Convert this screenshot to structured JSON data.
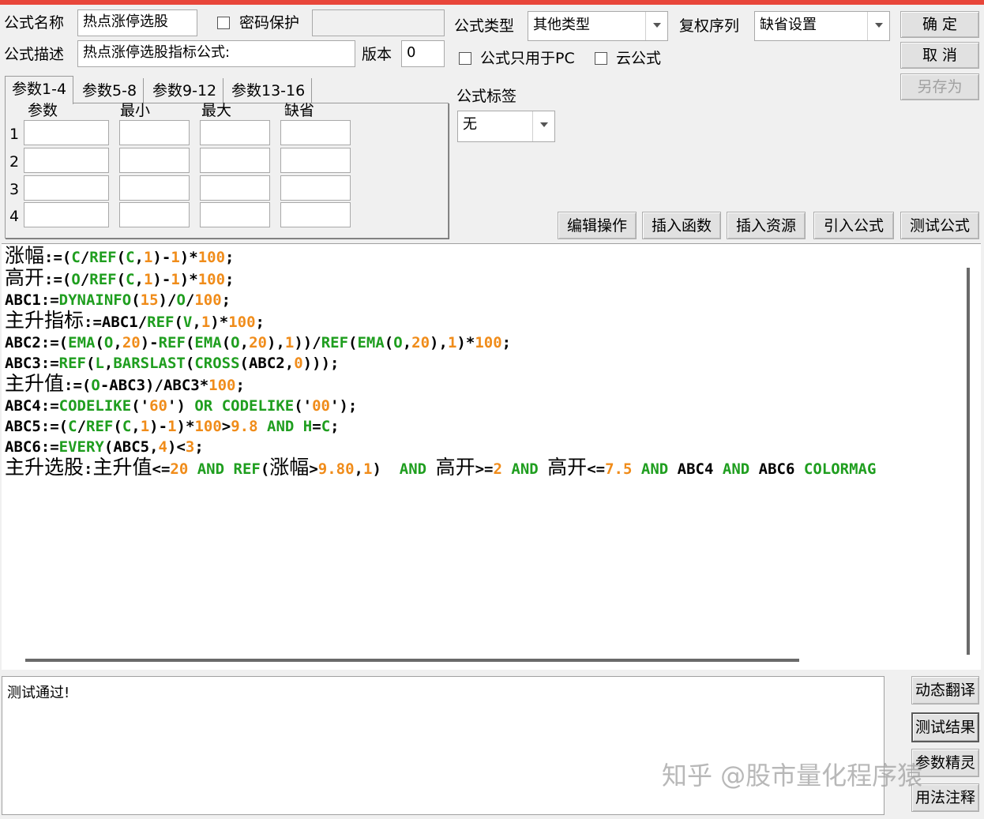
{
  "form": {
    "name_label": "公式名称",
    "name_value": "热点涨停选股",
    "password_label": "密码保护",
    "desc_label": "公式描述",
    "desc_value": "热点涨停选股指标公式:",
    "version_label": "版本",
    "version_value": "0",
    "type_label": "公式类型",
    "type_value": "其他类型",
    "fq_label": "复权序列",
    "fq_value": "缺省设置",
    "pc_only_label": "公式只用于PC",
    "cloud_label": "云公式",
    "tag_label": "公式标签",
    "tag_value": "无"
  },
  "buttons": {
    "ok": "确  定",
    "cancel": "取  消",
    "save_as": "另存为",
    "edit_ops": "编辑操作",
    "insert_func": "插入函数",
    "insert_res": "插入资源",
    "import_formula": "引入公式",
    "test_formula": "测试公式",
    "dyn_translate": "动态翻译",
    "test_result": "测试结果",
    "param_wizard": "参数精灵",
    "usage_notes": "用法注释"
  },
  "param_tabs": [
    "参数1-4",
    "参数5-8",
    "参数9-12",
    "参数13-16"
  ],
  "param_headers": [
    "参数",
    "最小",
    "最大",
    "缺省"
  ],
  "param_rows": [
    "1",
    "2",
    "3",
    "4"
  ],
  "code_lines": [
    "涨幅:=(C/REF(C,1)-1)*100;",
    "高开:=(O/REF(C,1)-1)*100;",
    "ABC1:=DYNAINFO(15)/O/100;",
    "主升指标:=ABC1/REF(V,1)*100;",
    "ABC2:=(EMA(O,20)-REF(EMA(O,20),1))/REF(EMA(O,20),1)*100;",
    "ABC3:=REF(L,BARSLAST(CROSS(ABC2,0)));",
    "主升值:=(O-ABC3)/ABC3*100;",
    "ABC4:=CODELIKE('60') OR CODELIKE('00');",
    "ABC5:=(C/REF(C,1)-1)*100>9.8 AND H=C;",
    "ABC6:=EVERY(ABC5,4)<3;",
    "主升选股:主升值<=20 AND REF(涨幅>9.80,1)  AND 高开>=2 AND 高开<=7.5 AND ABC4 AND ABC6 COLORMAG"
  ],
  "output_text": "测试通过!",
  "watermark": "知乎 @股市量化程序猿",
  "colors": {
    "keyword": "#000000",
    "function": "#1f9e1f",
    "number": "#f08c1a",
    "accent_top": "#e8463a"
  }
}
